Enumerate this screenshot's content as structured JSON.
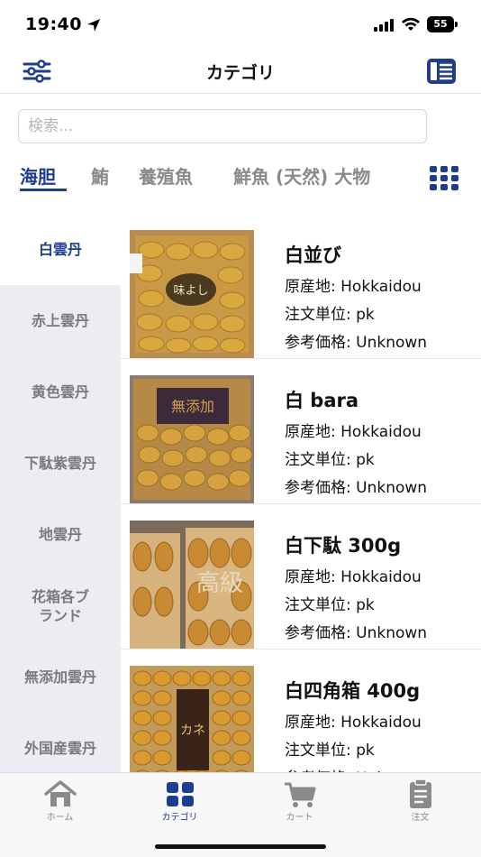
{
  "status_bar": {
    "time": "19:40",
    "battery": "55",
    "location-icon": "location-arrow-icon",
    "signal-icon": "cellular-signal-icon",
    "wifi-icon": "wifi-icon"
  },
  "header": {
    "title": "カテゴリ",
    "left_icon": "sliders-icon",
    "right_icon": "catalog-icon"
  },
  "search": {
    "placeholder": "検索..."
  },
  "top_tabs": {
    "items": [
      {
        "label": "海胆"
      },
      {
        "label": "鮪"
      },
      {
        "label": "養殖魚"
      },
      {
        "label": "鮮魚 (天然) 大物"
      }
    ],
    "active_index": 0,
    "grid_icon": "grid-icon"
  },
  "sidebar": {
    "items": [
      {
        "label": "白雲丹"
      },
      {
        "label": "赤上雲丹"
      },
      {
        "label": "黄色雲丹"
      },
      {
        "label": "下駄紫雲丹"
      },
      {
        "label": "地雲丹"
      },
      {
        "label": "花箱各ブランド"
      },
      {
        "label": "無添加雲丹"
      },
      {
        "label": "外国産雲丹"
      }
    ],
    "active_index": 0
  },
  "products": [
    {
      "name": "白並び",
      "origin": "原産地: Hokkaidou",
      "unit": "注文単位: pk",
      "price": "参考価格: Unknown",
      "label_text": "味よし"
    },
    {
      "name": "白 bara",
      "origin": "原産地: Hokkaidou",
      "unit": "注文単位: pk",
      "price": "参考価格: Unknown",
      "label_text": "無添加"
    },
    {
      "name": "白下駄 300g",
      "origin": "原産地: Hokkaidou",
      "unit": "注文単位: pk",
      "price": "参考価格: Unknown",
      "label_text": "高級"
    },
    {
      "name": "白四角箱 400g",
      "origin": "原産地: Hokkaidou",
      "unit": "注文単位: pk",
      "price": "参考価格: Unknown",
      "label_text": "カネ"
    }
  ],
  "tab_bar": {
    "items": [
      {
        "label": "ホーム",
        "icon": "home-icon"
      },
      {
        "label": "カテゴリ",
        "icon": "category-grid-icon"
      },
      {
        "label": "カート",
        "icon": "cart-icon"
      },
      {
        "label": "注文",
        "icon": "clipboard-icon"
      }
    ],
    "active_index": 1
  },
  "colors": {
    "accent": "#1e3d8f",
    "inactive": "#8a8a8a",
    "sidebar_bg": "#ecedf3"
  }
}
